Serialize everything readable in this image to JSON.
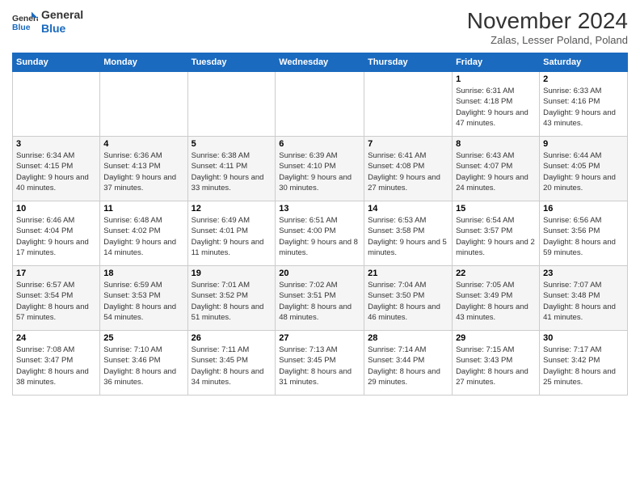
{
  "logo": {
    "text_general": "General",
    "text_blue": "Blue"
  },
  "header": {
    "month": "November 2024",
    "location": "Zalas, Lesser Poland, Poland"
  },
  "weekdays": [
    "Sunday",
    "Monday",
    "Tuesday",
    "Wednesday",
    "Thursday",
    "Friday",
    "Saturday"
  ],
  "weeks": [
    [
      {
        "day": "",
        "info": ""
      },
      {
        "day": "",
        "info": ""
      },
      {
        "day": "",
        "info": ""
      },
      {
        "day": "",
        "info": ""
      },
      {
        "day": "",
        "info": ""
      },
      {
        "day": "1",
        "info": "Sunrise: 6:31 AM\nSunset: 4:18 PM\nDaylight: 9 hours and 47 minutes."
      },
      {
        "day": "2",
        "info": "Sunrise: 6:33 AM\nSunset: 4:16 PM\nDaylight: 9 hours and 43 minutes."
      }
    ],
    [
      {
        "day": "3",
        "info": "Sunrise: 6:34 AM\nSunset: 4:15 PM\nDaylight: 9 hours and 40 minutes."
      },
      {
        "day": "4",
        "info": "Sunrise: 6:36 AM\nSunset: 4:13 PM\nDaylight: 9 hours and 37 minutes."
      },
      {
        "day": "5",
        "info": "Sunrise: 6:38 AM\nSunset: 4:11 PM\nDaylight: 9 hours and 33 minutes."
      },
      {
        "day": "6",
        "info": "Sunrise: 6:39 AM\nSunset: 4:10 PM\nDaylight: 9 hours and 30 minutes."
      },
      {
        "day": "7",
        "info": "Sunrise: 6:41 AM\nSunset: 4:08 PM\nDaylight: 9 hours and 27 minutes."
      },
      {
        "day": "8",
        "info": "Sunrise: 6:43 AM\nSunset: 4:07 PM\nDaylight: 9 hours and 24 minutes."
      },
      {
        "day": "9",
        "info": "Sunrise: 6:44 AM\nSunset: 4:05 PM\nDaylight: 9 hours and 20 minutes."
      }
    ],
    [
      {
        "day": "10",
        "info": "Sunrise: 6:46 AM\nSunset: 4:04 PM\nDaylight: 9 hours and 17 minutes."
      },
      {
        "day": "11",
        "info": "Sunrise: 6:48 AM\nSunset: 4:02 PM\nDaylight: 9 hours and 14 minutes."
      },
      {
        "day": "12",
        "info": "Sunrise: 6:49 AM\nSunset: 4:01 PM\nDaylight: 9 hours and 11 minutes."
      },
      {
        "day": "13",
        "info": "Sunrise: 6:51 AM\nSunset: 4:00 PM\nDaylight: 9 hours and 8 minutes."
      },
      {
        "day": "14",
        "info": "Sunrise: 6:53 AM\nSunset: 3:58 PM\nDaylight: 9 hours and 5 minutes."
      },
      {
        "day": "15",
        "info": "Sunrise: 6:54 AM\nSunset: 3:57 PM\nDaylight: 9 hours and 2 minutes."
      },
      {
        "day": "16",
        "info": "Sunrise: 6:56 AM\nSunset: 3:56 PM\nDaylight: 8 hours and 59 minutes."
      }
    ],
    [
      {
        "day": "17",
        "info": "Sunrise: 6:57 AM\nSunset: 3:54 PM\nDaylight: 8 hours and 57 minutes."
      },
      {
        "day": "18",
        "info": "Sunrise: 6:59 AM\nSunset: 3:53 PM\nDaylight: 8 hours and 54 minutes."
      },
      {
        "day": "19",
        "info": "Sunrise: 7:01 AM\nSunset: 3:52 PM\nDaylight: 8 hours and 51 minutes."
      },
      {
        "day": "20",
        "info": "Sunrise: 7:02 AM\nSunset: 3:51 PM\nDaylight: 8 hours and 48 minutes."
      },
      {
        "day": "21",
        "info": "Sunrise: 7:04 AM\nSunset: 3:50 PM\nDaylight: 8 hours and 46 minutes."
      },
      {
        "day": "22",
        "info": "Sunrise: 7:05 AM\nSunset: 3:49 PM\nDaylight: 8 hours and 43 minutes."
      },
      {
        "day": "23",
        "info": "Sunrise: 7:07 AM\nSunset: 3:48 PM\nDaylight: 8 hours and 41 minutes."
      }
    ],
    [
      {
        "day": "24",
        "info": "Sunrise: 7:08 AM\nSunset: 3:47 PM\nDaylight: 8 hours and 38 minutes."
      },
      {
        "day": "25",
        "info": "Sunrise: 7:10 AM\nSunset: 3:46 PM\nDaylight: 8 hours and 36 minutes."
      },
      {
        "day": "26",
        "info": "Sunrise: 7:11 AM\nSunset: 3:45 PM\nDaylight: 8 hours and 34 minutes."
      },
      {
        "day": "27",
        "info": "Sunrise: 7:13 AM\nSunset: 3:45 PM\nDaylight: 8 hours and 31 minutes."
      },
      {
        "day": "28",
        "info": "Sunrise: 7:14 AM\nSunset: 3:44 PM\nDaylight: 8 hours and 29 minutes."
      },
      {
        "day": "29",
        "info": "Sunrise: 7:15 AM\nSunset: 3:43 PM\nDaylight: 8 hours and 27 minutes."
      },
      {
        "day": "30",
        "info": "Sunrise: 7:17 AM\nSunset: 3:42 PM\nDaylight: 8 hours and 25 minutes."
      }
    ]
  ]
}
